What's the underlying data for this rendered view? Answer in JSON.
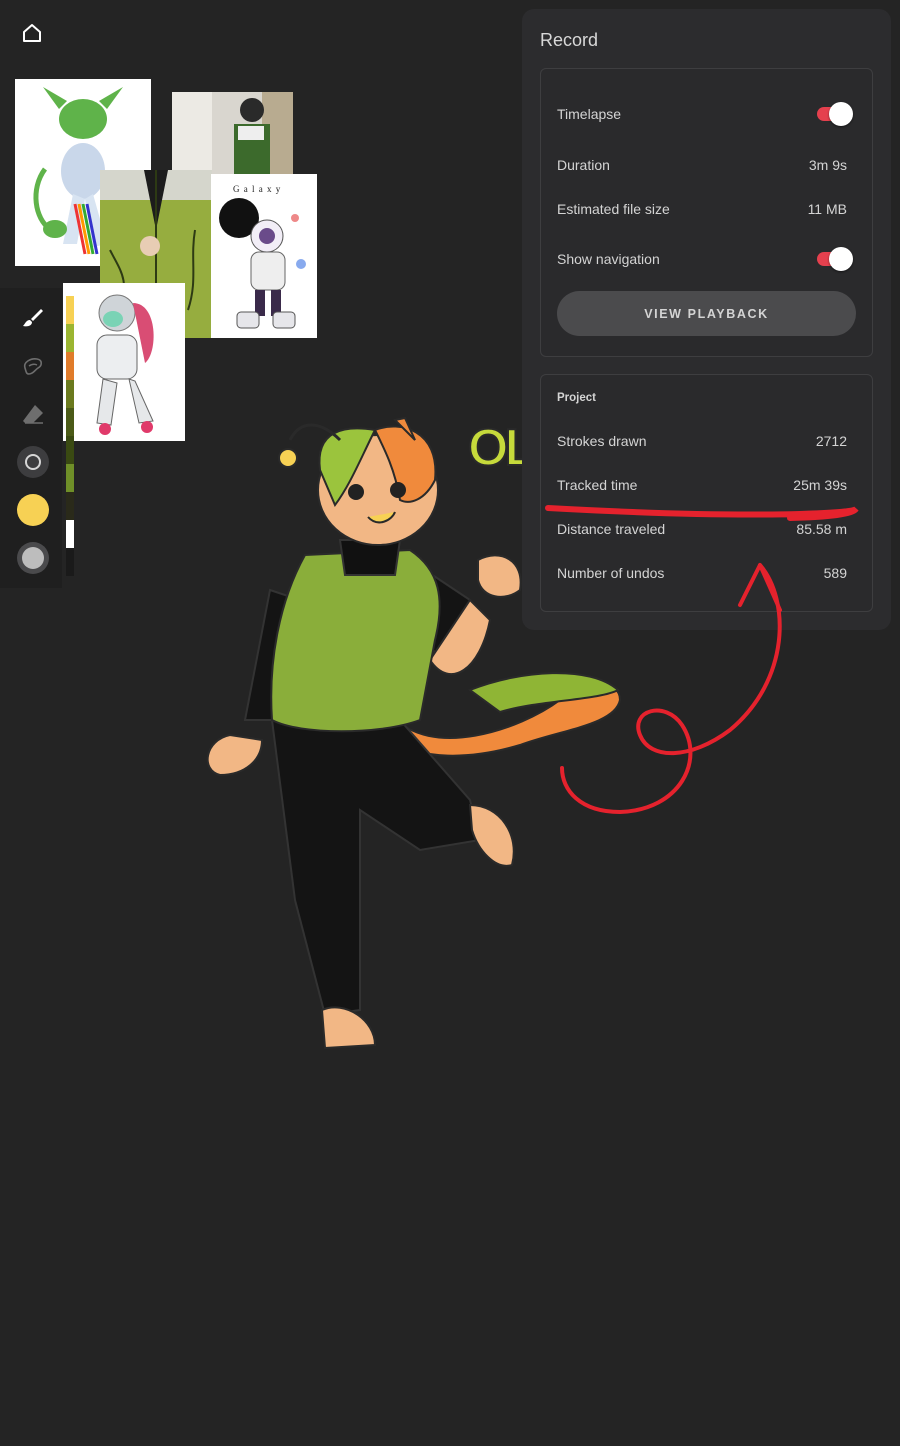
{
  "panel": {
    "title": "Record",
    "record": {
      "timelapse_label": "Timelapse",
      "timelapse_on": true,
      "duration_label": "Duration",
      "duration_value": "3m 9s",
      "filesize_label": "Estimated file size",
      "filesize_value": "11 MB",
      "navigation_label": "Show navigation",
      "navigation_on": true,
      "playback_button": "VIEW PLAYBACK"
    },
    "project": {
      "heading": "Project",
      "strokes_label": "Strokes drawn",
      "strokes_value": "2712",
      "tracked_label": "Tracked time",
      "tracked_value": "25m 39s",
      "distance_label": "Distance traveled",
      "distance_value": "85.58 m",
      "undos_label": "Number of undos",
      "undos_value": "589"
    }
  },
  "references": {
    "galaxy_text": "G a l a x y",
    "canvas_sign_text": "OLI"
  },
  "toolbar": {
    "tools": [
      "brush-icon",
      "smudge-icon",
      "eraser-icon",
      "brush-size-icon",
      "color-icon",
      "opacity-icon"
    ],
    "current_color": "#f7d154"
  },
  "palette": [
    "#f7d154",
    "#9bb531",
    "#e07b2a",
    "#6b7a1e",
    "#4b5a17",
    "#3a4a12",
    "#6f8f28",
    "#2a2a1a",
    "#ffffff",
    "#1a1a1a"
  ],
  "colors": {
    "accent_toggle": "#e5404e",
    "annotation_red": "#e5222d",
    "panel_bg": "#2c2c2e",
    "canvas_bg": "#242424"
  }
}
